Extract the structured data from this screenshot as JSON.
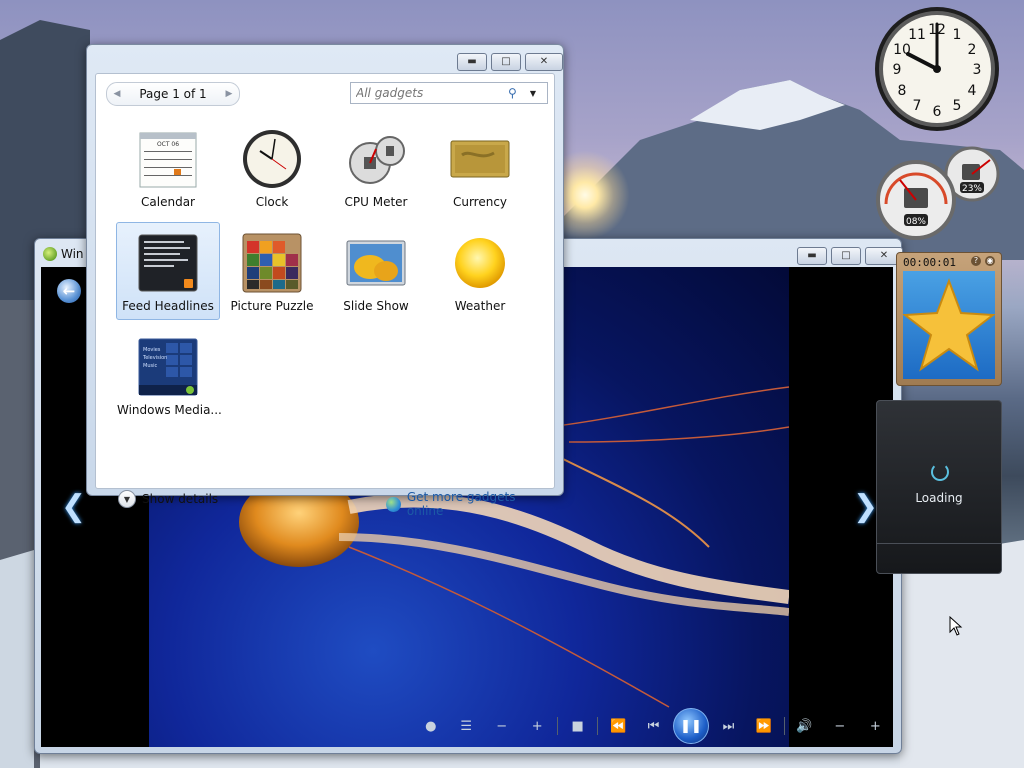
{
  "gallery": {
    "pager_label": "Page 1 of 1",
    "search_placeholder": "All gadgets",
    "gadgets": [
      {
        "name": "Calendar"
      },
      {
        "name": "Clock"
      },
      {
        "name": "CPU Meter"
      },
      {
        "name": "Currency"
      },
      {
        "name": "Feed Headlines",
        "selected": true
      },
      {
        "name": "Picture Puzzle"
      },
      {
        "name": "Slide Show"
      },
      {
        "name": "Weather"
      },
      {
        "name": "Windows Media..."
      }
    ],
    "calendar_month": "OCT 06",
    "show_details_label": "Show details",
    "get_more_label": "Get more gadgets online"
  },
  "media_window": {
    "title": "Win"
  },
  "sidebar": {
    "clock_numbers": [
      "12",
      "1",
      "2",
      "3",
      "4",
      "5",
      "6",
      "7",
      "8",
      "9",
      "10",
      "11"
    ],
    "cpu_percent": "08%",
    "mem_percent": "23%",
    "puzzle_timer": "00:00:01",
    "feed_status": "Loading"
  },
  "wmp_tile_items": [
    "Movies",
    "Television",
    "Music"
  ],
  "colors": {
    "accent": "#1c5aa6",
    "selection": "#cfe2f8"
  }
}
